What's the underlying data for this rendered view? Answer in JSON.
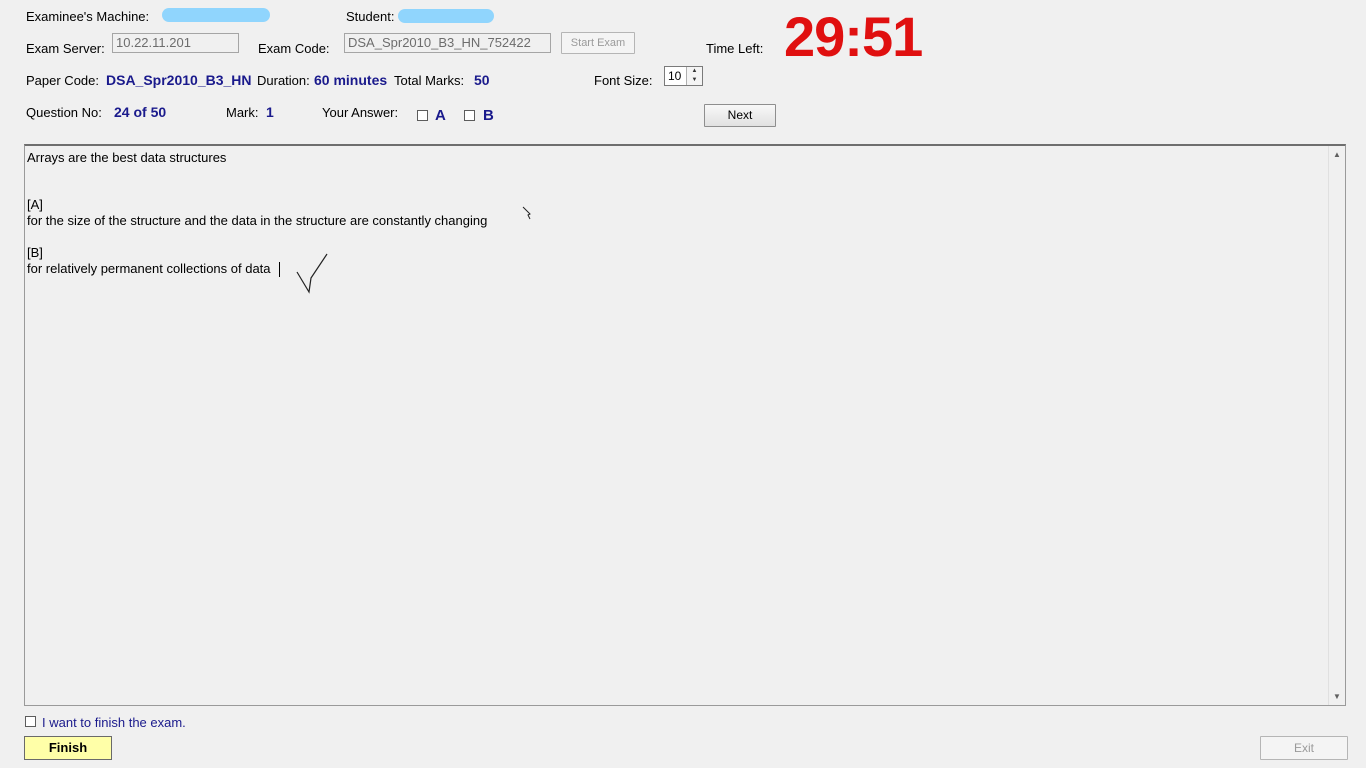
{
  "header": {
    "examinee_label": "Examinee's Machine:",
    "student_label": "Student:",
    "server_label": "Exam Server:",
    "server_value": "10.22.11.201",
    "exam_code_label": "Exam Code:",
    "exam_code_value": "DSA_Spr2010_B3_HN_752422",
    "start_exam_label": "Start Exam",
    "time_left_label": "Time Left:",
    "time_left_value": "29:51",
    "paper_code_label": "Paper Code:",
    "paper_code_value": "DSA_Spr2010_B3_HN",
    "duration_label": "Duration:",
    "duration_value": "60 minutes",
    "total_marks_label": "Total Marks:",
    "total_marks_value": "50",
    "font_size_label": "Font Size:",
    "font_size_value": "10",
    "question_no_label": "Question No:",
    "question_no_value": "24 of 50",
    "mark_label": "Mark:",
    "mark_value": "1",
    "your_answer_label": "Your Answer:",
    "answer_options": [
      "A",
      "B"
    ],
    "next_label": "Next"
  },
  "question": {
    "stem": "Arrays are the best data structures",
    "option_a_tag": "[A]",
    "option_a_text": "for the size of the structure and the data in the structure are constantly changing",
    "option_b_tag": "[B]",
    "option_b_text": "for relatively permanent collections of data"
  },
  "footer": {
    "finish_confirm_label": "I want to finish the exam.",
    "finish_label": "Finish",
    "exit_label": "Exit"
  },
  "colors": {
    "timer": "#e01010",
    "value_text": "#1a1a8c",
    "finish_button": "#ffffa8",
    "redaction": "#7fd0ff"
  }
}
